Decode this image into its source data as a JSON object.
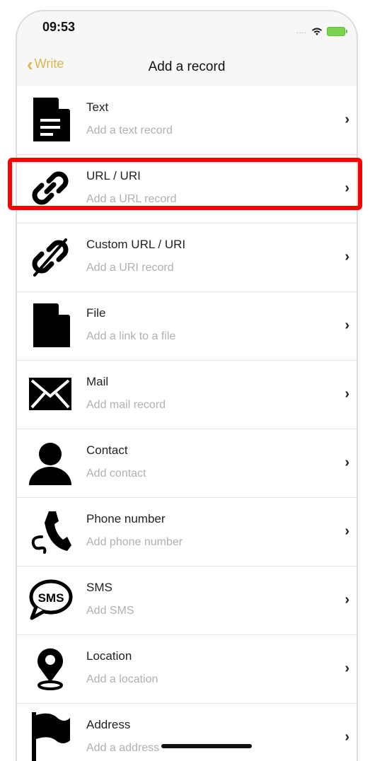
{
  "status_bar": {
    "time": "09:53",
    "signal": "....",
    "wifi_icon": "wifi-icon",
    "battery_icon": "battery-icon"
  },
  "nav": {
    "back_label": "Write",
    "title": "Add a record"
  },
  "colors": {
    "accent": "#d9b84a",
    "highlight": "#ff0000"
  },
  "records": [
    {
      "id": "text",
      "title": "Text",
      "subtitle": "Add a text record",
      "icon": "document-text-icon"
    },
    {
      "id": "url",
      "title": "URL / URI",
      "subtitle": "Add a URL record",
      "icon": "link-icon"
    },
    {
      "id": "custom-url",
      "title": "Custom URL / URI",
      "subtitle": "Add a URI record",
      "icon": "broken-link-icon"
    },
    {
      "id": "file",
      "title": "File",
      "subtitle": "Add a link to a file",
      "icon": "file-icon"
    },
    {
      "id": "mail",
      "title": "Mail",
      "subtitle": "Add mail record",
      "icon": "envelope-icon"
    },
    {
      "id": "contact",
      "title": "Contact",
      "subtitle": "Add contact",
      "icon": "person-icon"
    },
    {
      "id": "phone",
      "title": "Phone number",
      "subtitle": "Add phone number",
      "icon": "phone-icon"
    },
    {
      "id": "sms",
      "title": "SMS",
      "subtitle": "Add SMS",
      "icon": "sms-bubble-icon"
    },
    {
      "id": "location",
      "title": "Location",
      "subtitle": "Add a location",
      "icon": "map-pin-icon"
    },
    {
      "id": "address",
      "title": "Address",
      "subtitle": "Add a address",
      "icon": "flag-icon"
    }
  ]
}
